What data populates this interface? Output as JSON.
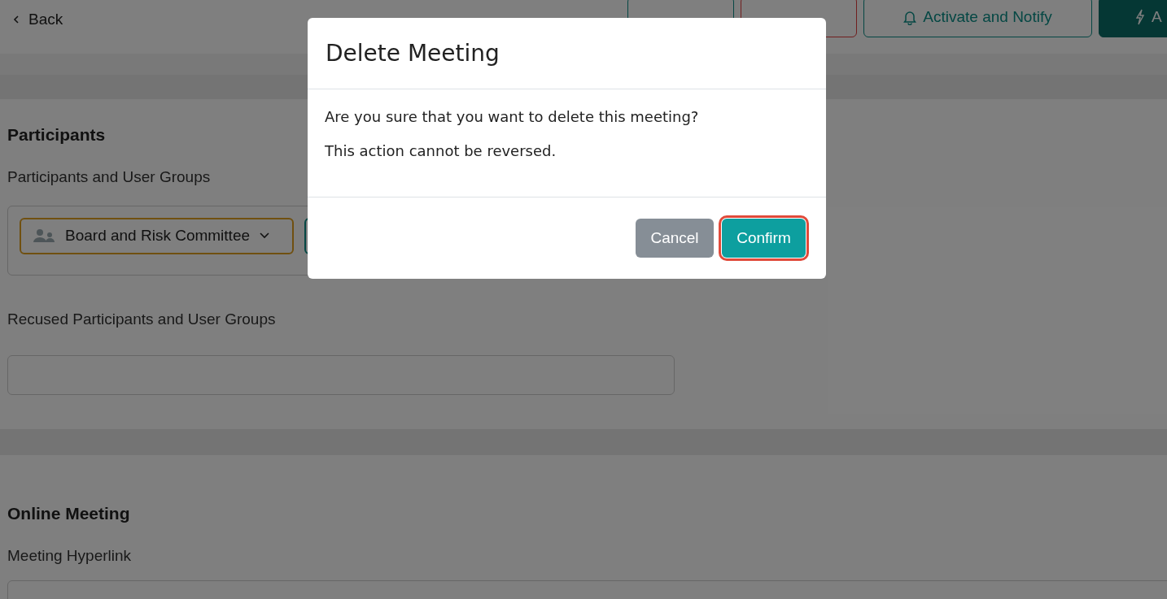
{
  "page": {
    "back": "Back",
    "actions": [
      {
        "kind": "outline"
      },
      {
        "kind": "danger"
      },
      {
        "label": "Activate and Notify",
        "kind": "notify"
      },
      {
        "label": "A",
        "kind": "primary"
      }
    ],
    "participants": {
      "title": "Participants",
      "label": "Participants and User Groups",
      "chips": [
        "Board and Risk Committee"
      ],
      "recused_label": "Recused Participants and User Groups"
    },
    "online": {
      "title": "Online Meeting",
      "label": "Meeting Hyperlink"
    }
  },
  "dialog": {
    "title": "Delete Meeting",
    "lines": [
      "Are you sure that you want to delete this meeting?",
      "This action cannot be reversed."
    ],
    "buttons": [
      {
        "label": "Cancel",
        "kind": "secondary",
        "focused": false
      },
      {
        "label": "Confirm",
        "kind": "primary",
        "focused": true
      }
    ]
  }
}
